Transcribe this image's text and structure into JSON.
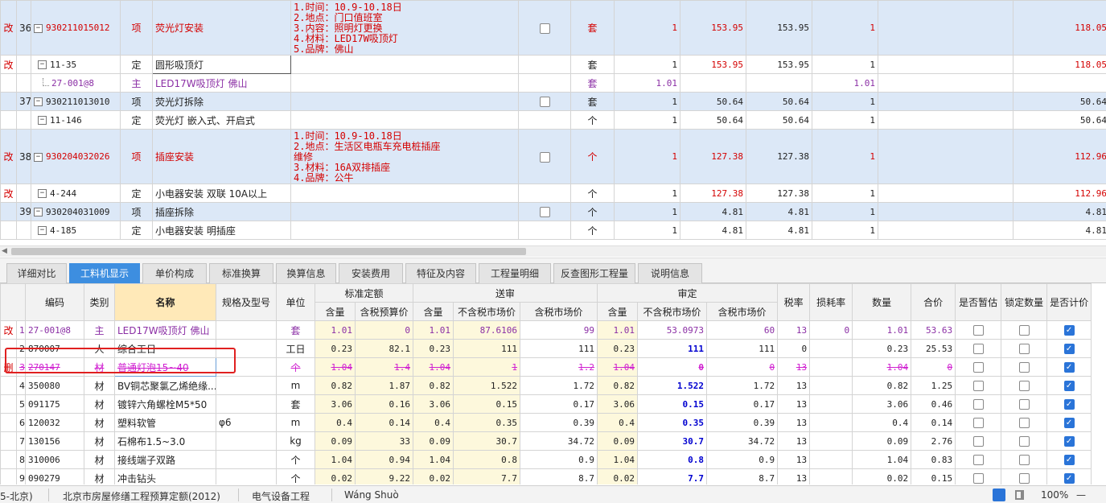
{
  "top_rows": [
    {
      "flag": "改",
      "no": "36",
      "code": "930211015012",
      "type": "项",
      "name": "荧光灯安装",
      "desc": [
        "1.时间：10.9-10.18日",
        "2.地点：门口值班室",
        "3.内容：照明灯更换",
        "4.材料：LED17W吸顶灯",
        "5.品牌：佛山"
      ],
      "unit": "套",
      "qty": "1",
      "p1": "153.95",
      "p2": "153.95",
      "q2": "1",
      "r1": "118.05",
      "r2": "118."
    },
    {
      "flag": "改",
      "no": "",
      "code": "11-35",
      "type": "定",
      "name": "圆形吸顶灯",
      "unit": "套",
      "qty": "1",
      "p1": "153.95",
      "p2": "153.95",
      "q2": "1",
      "r1": "118.05",
      "r2": "118."
    },
    {
      "flag": "",
      "no": "",
      "code": "27-001@8",
      "type": "主",
      "name": "LED17W吸顶灯 佛山",
      "unit": "套",
      "qty": "1.01",
      "p1": "",
      "p2": "",
      "q2": "1.01",
      "r1": "",
      "r2": ""
    },
    {
      "flag": "",
      "no": "37",
      "code": "930211013010",
      "type": "项",
      "name": "荧光灯拆除",
      "unit": "套",
      "qty": "1",
      "p1": "50.64",
      "p2": "50.64",
      "q2": "1",
      "r1": "50.64",
      "r2": "50."
    },
    {
      "flag": "",
      "no": "",
      "code": "11-146",
      "type": "定",
      "name": "荧光灯 嵌入式、开启式",
      "unit": "个",
      "qty": "1",
      "p1": "50.64",
      "p2": "50.64",
      "q2": "1",
      "r1": "50.64",
      "r2": "50."
    },
    {
      "flag": "改",
      "no": "38",
      "code": "930204032026",
      "type": "项",
      "name": "插座安装",
      "desc": [
        "1.时间：10.9-10.18日",
        "2.地点：生活区电瓶车充电桩插座",
        "维修",
        "3.材料：16A双排插座",
        "4.品牌：公牛"
      ],
      "unit": "个",
      "qty": "1",
      "p1": "127.38",
      "p2": "127.38",
      "q2": "1",
      "r1": "112.96",
      "r2": "112."
    },
    {
      "flag": "改",
      "no": "",
      "code": "4-244",
      "type": "定",
      "name": "小电器安装 双联 10A以上",
      "unit": "个",
      "qty": "1",
      "p1": "127.38",
      "p2": "127.38",
      "q2": "1",
      "r1": "112.96",
      "r2": "112."
    },
    {
      "flag": "",
      "no": "39",
      "code": "930204031009",
      "type": "项",
      "name": "插座拆除",
      "unit": "个",
      "qty": "1",
      "p1": "4.81",
      "p2": "4.81",
      "q2": "1",
      "r1": "4.81",
      "r2": "4."
    },
    {
      "flag": "",
      "no": "",
      "code": "4-185",
      "type": "定",
      "name": "小电器安装 明插座",
      "unit": "个",
      "qty": "1",
      "p1": "4.81",
      "p2": "4.81",
      "q2": "1",
      "r1": "4.81",
      "r2": "4."
    }
  ],
  "tabs": [
    "详细对比",
    "工料机显示",
    "单价构成",
    "标准换算",
    "换算信息",
    "安装费用",
    "特征及内容",
    "工程量明细",
    "反查图形工程量",
    "说明信息"
  ],
  "headers": {
    "code": "编码",
    "type": "类别",
    "name": "名称",
    "spec": "规格及型号",
    "unit": "单位",
    "std": "标准定额",
    "send": "送审",
    "audit": "审定",
    "qty": "含量",
    "tax_budget": "含税预算价",
    "notax": "不含税市场价",
    "tax": "含税市场价",
    "rate": "税率",
    "loss": "损耗率",
    "count": "数量",
    "total": "合价",
    "provisional": "是否暂估",
    "lock": "锁定数量",
    "priced": "是否计价"
  },
  "bottom_rows": [
    {
      "flag": "改",
      "no": "1",
      "code": "27-001@8",
      "type": "主",
      "name": "LED17W吸顶灯 佛山",
      "spec": "",
      "unit": "套",
      "a": "1.01",
      "b": "0",
      "c": "1.01",
      "d": "87.6106",
      "e": "99",
      "f": "1.01",
      "g": "53.0973",
      "h": "60",
      "rate": "13",
      "loss": "0",
      "count": "1.01",
      "total": "53.63",
      "c1": false,
      "c2": false,
      "c3": true
    },
    {
      "flag": "",
      "no": "2",
      "code": "870007",
      "type": "人",
      "name": "综合工日",
      "spec": "",
      "unit": "工日",
      "a": "0.23",
      "b": "82.1",
      "c": "0.23",
      "d": "111",
      "e": "111",
      "f": "0.23",
      "g": "111",
      "h": "111",
      "rate": "0",
      "loss": "",
      "count": "0.23",
      "total": "25.53",
      "c1": false,
      "c2": false,
      "c3": true
    },
    {
      "flag": "删",
      "no": "3",
      "code": "270147",
      "type": "材",
      "name": "普通灯泡15~40",
      "spec": "",
      "unit": "个",
      "a": "1.04",
      "b": "1.4",
      "c": "1.04",
      "d": "1",
      "e": "1.2",
      "f": "1.04",
      "g": "0",
      "h": "0",
      "rate": "13",
      "loss": "",
      "count": "1.04",
      "total": "0",
      "c1": false,
      "c2": false,
      "c3": true
    },
    {
      "flag": "",
      "no": "4",
      "code": "350080",
      "type": "材",
      "name": "BV铜芯聚氯乙烯绝缘...",
      "spec": "",
      "unit": "m",
      "a": "0.82",
      "b": "1.87",
      "c": "0.82",
      "d": "1.522",
      "e": "1.72",
      "f": "0.82",
      "g": "1.522",
      "h": "1.72",
      "rate": "13",
      "loss": "",
      "count": "0.82",
      "total": "1.25",
      "c1": false,
      "c2": false,
      "c3": true
    },
    {
      "flag": "",
      "no": "5",
      "code": "091175",
      "type": "材",
      "name": "镀锌六角螺栓M5*50",
      "spec": "",
      "unit": "套",
      "a": "3.06",
      "b": "0.16",
      "c": "3.06",
      "d": "0.15",
      "e": "0.17",
      "f": "3.06",
      "g": "0.15",
      "h": "0.17",
      "rate": "13",
      "loss": "",
      "count": "3.06",
      "total": "0.46",
      "c1": false,
      "c2": false,
      "c3": true
    },
    {
      "flag": "",
      "no": "6",
      "code": "120032",
      "type": "材",
      "name": "塑料软管",
      "spec": "φ6",
      "unit": "m",
      "a": "0.4",
      "b": "0.14",
      "c": "0.4",
      "d": "0.35",
      "e": "0.39",
      "f": "0.4",
      "g": "0.35",
      "h": "0.39",
      "rate": "13",
      "loss": "",
      "count": "0.4",
      "total": "0.14",
      "c1": false,
      "c2": false,
      "c3": true
    },
    {
      "flag": "",
      "no": "7",
      "code": "130156",
      "type": "材",
      "name": "石棉布1.5~3.0",
      "spec": "",
      "unit": "kg",
      "a": "0.09",
      "b": "33",
      "c": "0.09",
      "d": "30.7",
      "e": "34.72",
      "f": "0.09",
      "g": "30.7",
      "h": "34.72",
      "rate": "13",
      "loss": "",
      "count": "0.09",
      "total": "2.76",
      "c1": false,
      "c2": false,
      "c3": true
    },
    {
      "flag": "",
      "no": "8",
      "code": "310006",
      "type": "材",
      "name": "接线端子双路",
      "spec": "",
      "unit": "个",
      "a": "1.04",
      "b": "0.94",
      "c": "1.04",
      "d": "0.8",
      "e": "0.9",
      "f": "1.04",
      "g": "0.8",
      "h": "0.9",
      "rate": "13",
      "loss": "",
      "count": "1.04",
      "total": "0.83",
      "c1": false,
      "c2": false,
      "c3": true
    },
    {
      "flag": "",
      "no": "9",
      "code": "090279",
      "type": "材",
      "name": "冲击钻头",
      "spec": "",
      "unit": "个",
      "a": "0.02",
      "b": "9.22",
      "c": "0.02",
      "d": "7.7",
      "e": "8.7",
      "f": "0.02",
      "g": "7.7",
      "h": "8.7",
      "rate": "13",
      "loss": "",
      "count": "0.02",
      "total": "0.15",
      "c1": false,
      "c2": false,
      "c3": true
    }
  ],
  "status": {
    "s1": "5-北京)",
    "s2": "北京市房屋修缮工程预算定额(2012)",
    "s3": "电气设备工程",
    "s4": "Wáng Shuò",
    "zoom": "100%",
    "minus": "—"
  }
}
